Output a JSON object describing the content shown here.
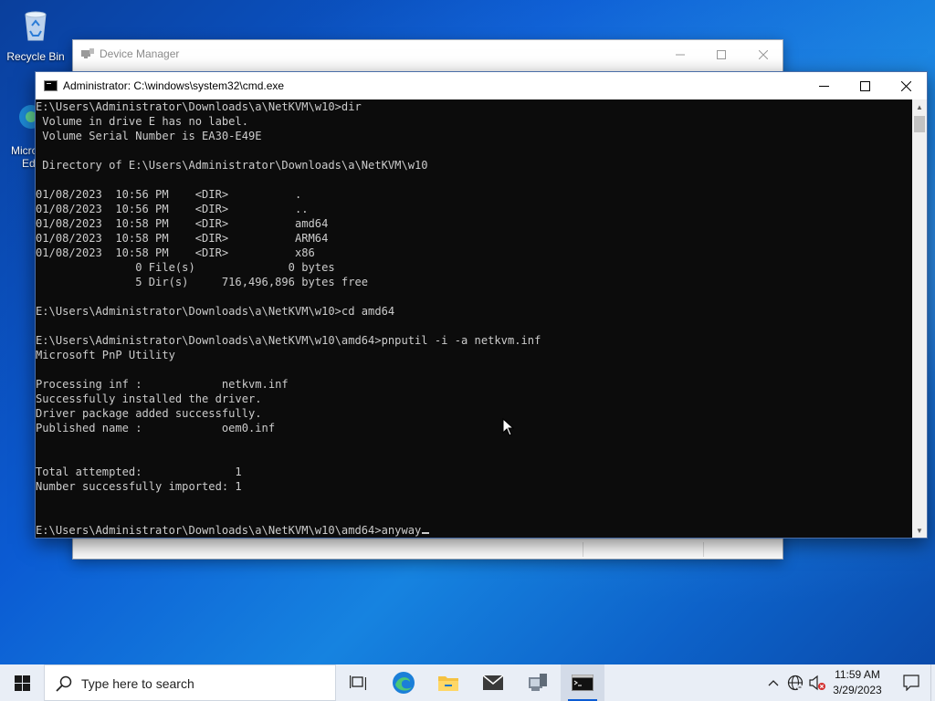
{
  "desktop": {
    "icons": [
      {
        "label": "Recycle Bin"
      },
      {
        "label": "Microsoft Edge",
        "label_line1": "Micro",
        "label_line2": "Ed"
      }
    ]
  },
  "device_manager": {
    "title": "Device Manager"
  },
  "cmd": {
    "title": "Administrator: C:\\windows\\system32\\cmd.exe",
    "lines": [
      "E:\\Users\\Administrator\\Downloads\\a\\NetKVM\\w10>dir",
      " Volume in drive E has no label.",
      " Volume Serial Number is EA30-E49E",
      "",
      " Directory of E:\\Users\\Administrator\\Downloads\\a\\NetKVM\\w10",
      "",
      "01/08/2023  10:56 PM    <DIR>          .",
      "01/08/2023  10:56 PM    <DIR>          ..",
      "01/08/2023  10:58 PM    <DIR>          amd64",
      "01/08/2023  10:58 PM    <DIR>          ARM64",
      "01/08/2023  10:58 PM    <DIR>          x86",
      "               0 File(s)              0 bytes",
      "               5 Dir(s)     716,496,896 bytes free",
      "",
      "E:\\Users\\Administrator\\Downloads\\a\\NetKVM\\w10>cd amd64",
      "",
      "E:\\Users\\Administrator\\Downloads\\a\\NetKVM\\w10\\amd64>pnputil -i -a netkvm.inf",
      "Microsoft PnP Utility",
      "",
      "Processing inf :            netkvm.inf",
      "Successfully installed the driver.",
      "Driver package added successfully.",
      "Published name :            oem0.inf",
      "",
      "",
      "Total attempted:              1",
      "Number successfully imported: 1",
      "",
      "",
      "E:\\Users\\Administrator\\Downloads\\a\\NetKVM\\w10\\amd64>anyway"
    ]
  },
  "taskbar": {
    "search_placeholder": "Type here to search",
    "time": "11:59 AM",
    "date": "3/29/2023",
    "apps": [
      "task-view",
      "edge",
      "file-explorer",
      "mail",
      "device-manager",
      "cmd"
    ],
    "accent": "#0b5bd3"
  }
}
